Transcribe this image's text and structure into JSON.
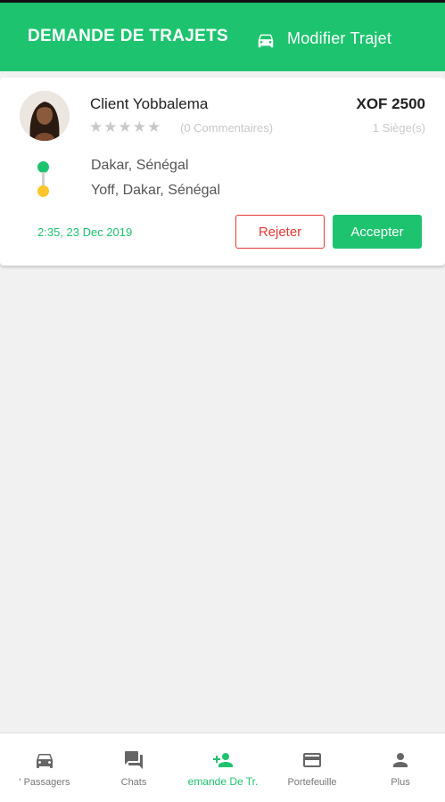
{
  "header": {
    "title": "DEMANDE DE TRAJETS",
    "action_icon": "car-icon",
    "action_label": "Modifier Trajet"
  },
  "request": {
    "client_name": "Client Yobbalema",
    "price": "XOF 2500",
    "rating_stars": 5,
    "rating_value": 0,
    "reviews": "(0 Commentaires)",
    "seats": "1 Siège(s)",
    "origin": "Dakar, Sénégal",
    "destination": "Yoff, Dakar, Sénégal",
    "datetime": "2:35, 23 Dec 2019",
    "reject_label": "Rejeter",
    "accept_label": "Accepter"
  },
  "bottom_nav": {
    "items": [
      {
        "label": "' Passagers",
        "icon": "car-icon"
      },
      {
        "label": "Chats",
        "icon": "chat-icon"
      },
      {
        "label": "emande De Tr.",
        "icon": "person-add-icon",
        "active": true
      },
      {
        "label": "Portefeuille",
        "icon": "wallet-icon"
      },
      {
        "label": "Plus",
        "icon": "person-icon"
      }
    ]
  },
  "colors": {
    "primary": "#1ec36f",
    "reject": "#e53935",
    "destination_dot": "#ffc62b",
    "star_empty": "#c8c8c8"
  }
}
